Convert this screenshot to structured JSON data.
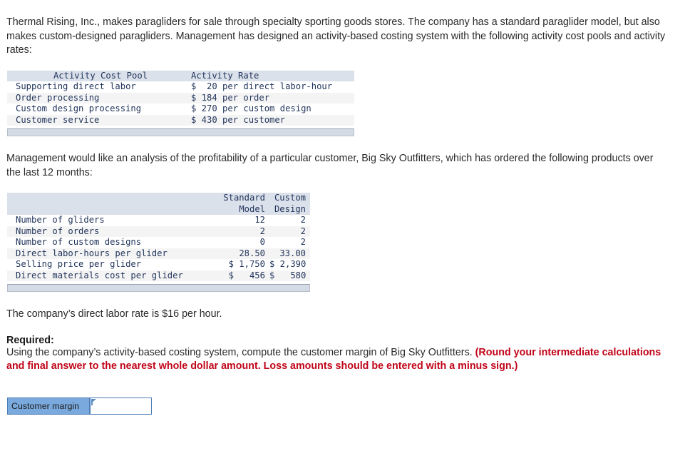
{
  "intro": {
    "paragraph_1": "Thermal Rising, Inc., makes paragliders for sale through specialty sporting goods stores. The company has a standard paraglider model, but also makes custom-designed paragliders. Management has designed an activity-based costing system with the following activity cost pools and activity rates:",
    "paragraph_2": "Management would like an analysis of the profitability of a particular customer, Big Sky Outfitters, which has ordered the following products over the last 12 months:",
    "paragraph_3": "The company’s direct labor rate is $16 per hour."
  },
  "activity_table": {
    "headers": [
      "Activity Cost Pool",
      "Activity Rate"
    ],
    "rows": [
      {
        "pool": "Supporting direct labor",
        "currency": "$",
        "amount": "20",
        "unit": "per direct labor-hour"
      },
      {
        "pool": "Order processing",
        "currency": "$",
        "amount": "184",
        "unit": "per order"
      },
      {
        "pool": "Custom design processing",
        "currency": "$",
        "amount": "270",
        "unit": "per custom design"
      },
      {
        "pool": "Customer service",
        "currency": "$",
        "amount": "430",
        "unit": "per customer"
      }
    ]
  },
  "products_table": {
    "headers": {
      "item": "",
      "standard_line1": "Standard",
      "standard_line2": "Model",
      "custom_line1": "Custom",
      "custom_line2": "Design"
    },
    "rows": [
      {
        "item": "Number of gliders",
        "standard": "12",
        "custom": "2"
      },
      {
        "item": "Number of orders",
        "standard": "2",
        "custom": "2"
      },
      {
        "item": "Number of custom designs",
        "standard": "0",
        "custom": "2"
      },
      {
        "item": "Direct labor-hours per glider",
        "standard": "28.50",
        "custom": "33.00"
      },
      {
        "item": "Selling price per glider",
        "standard": "$ 1,750",
        "custom": "$ 2,390"
      },
      {
        "item": "Direct materials cost per glider",
        "standard": "$   456",
        "custom": "$   580"
      }
    ]
  },
  "required": {
    "label": "Required:",
    "body_normal": "Using the company’s activity-based costing system, compute the customer margin of Big Sky Outfitters. ",
    "body_red": "(Round your intermediate calculations and final answer to the nearest whole dollar amount. Loss amounts should be entered with a minus sign.)"
  },
  "answer": {
    "label": "Customer margin",
    "value": "",
    "placeholder": ""
  },
  "colors": {
    "table_header_fill": "#dbe1ea",
    "table_stripe": "#f4f4f4",
    "mono_text": "#22355c",
    "red_instruction": "#c00418",
    "answer_label_fill": "#7aa9dd",
    "answer_border": "#4b7cb5",
    "scrollbar_fill": "#d4dbe4"
  }
}
